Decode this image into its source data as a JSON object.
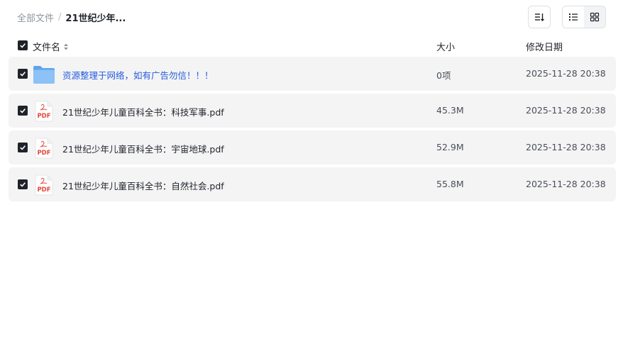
{
  "breadcrumb": {
    "root": "全部文件",
    "separator": "/",
    "current": "21世纪少年..."
  },
  "toolbar": {
    "sort_icon": "sort-descending-icon",
    "list_view_icon": "list-view-icon",
    "grid_view_icon": "grid-view-icon"
  },
  "columns": {
    "name": "文件名",
    "size": "大小",
    "date": "修改日期"
  },
  "files": [
    {
      "type": "folder",
      "name": "资源整理于网络，如有广告勿信！！！",
      "size": "0项",
      "date": "2025-11-28 20:38"
    },
    {
      "type": "pdf",
      "name": "21世纪少年儿童百科全书：科技军事.pdf",
      "size": "45.3M",
      "date": "2025-11-28 20:38"
    },
    {
      "type": "pdf",
      "name": "21世纪少年儿童百科全书：宇宙地球.pdf",
      "size": "52.9M",
      "date": "2025-11-28 20:38"
    },
    {
      "type": "pdf",
      "name": "21世纪少年儿童百科全书：自然社会.pdf",
      "size": "55.8M",
      "date": "2025-11-28 20:38"
    }
  ],
  "pdf_icon_label": "PDF",
  "colors": {
    "checkbox": "#1f2329",
    "folder": "#7fb8f2",
    "pdf": "#e5473b",
    "link": "#245bdb",
    "row_bg": "#f4f4f5"
  }
}
